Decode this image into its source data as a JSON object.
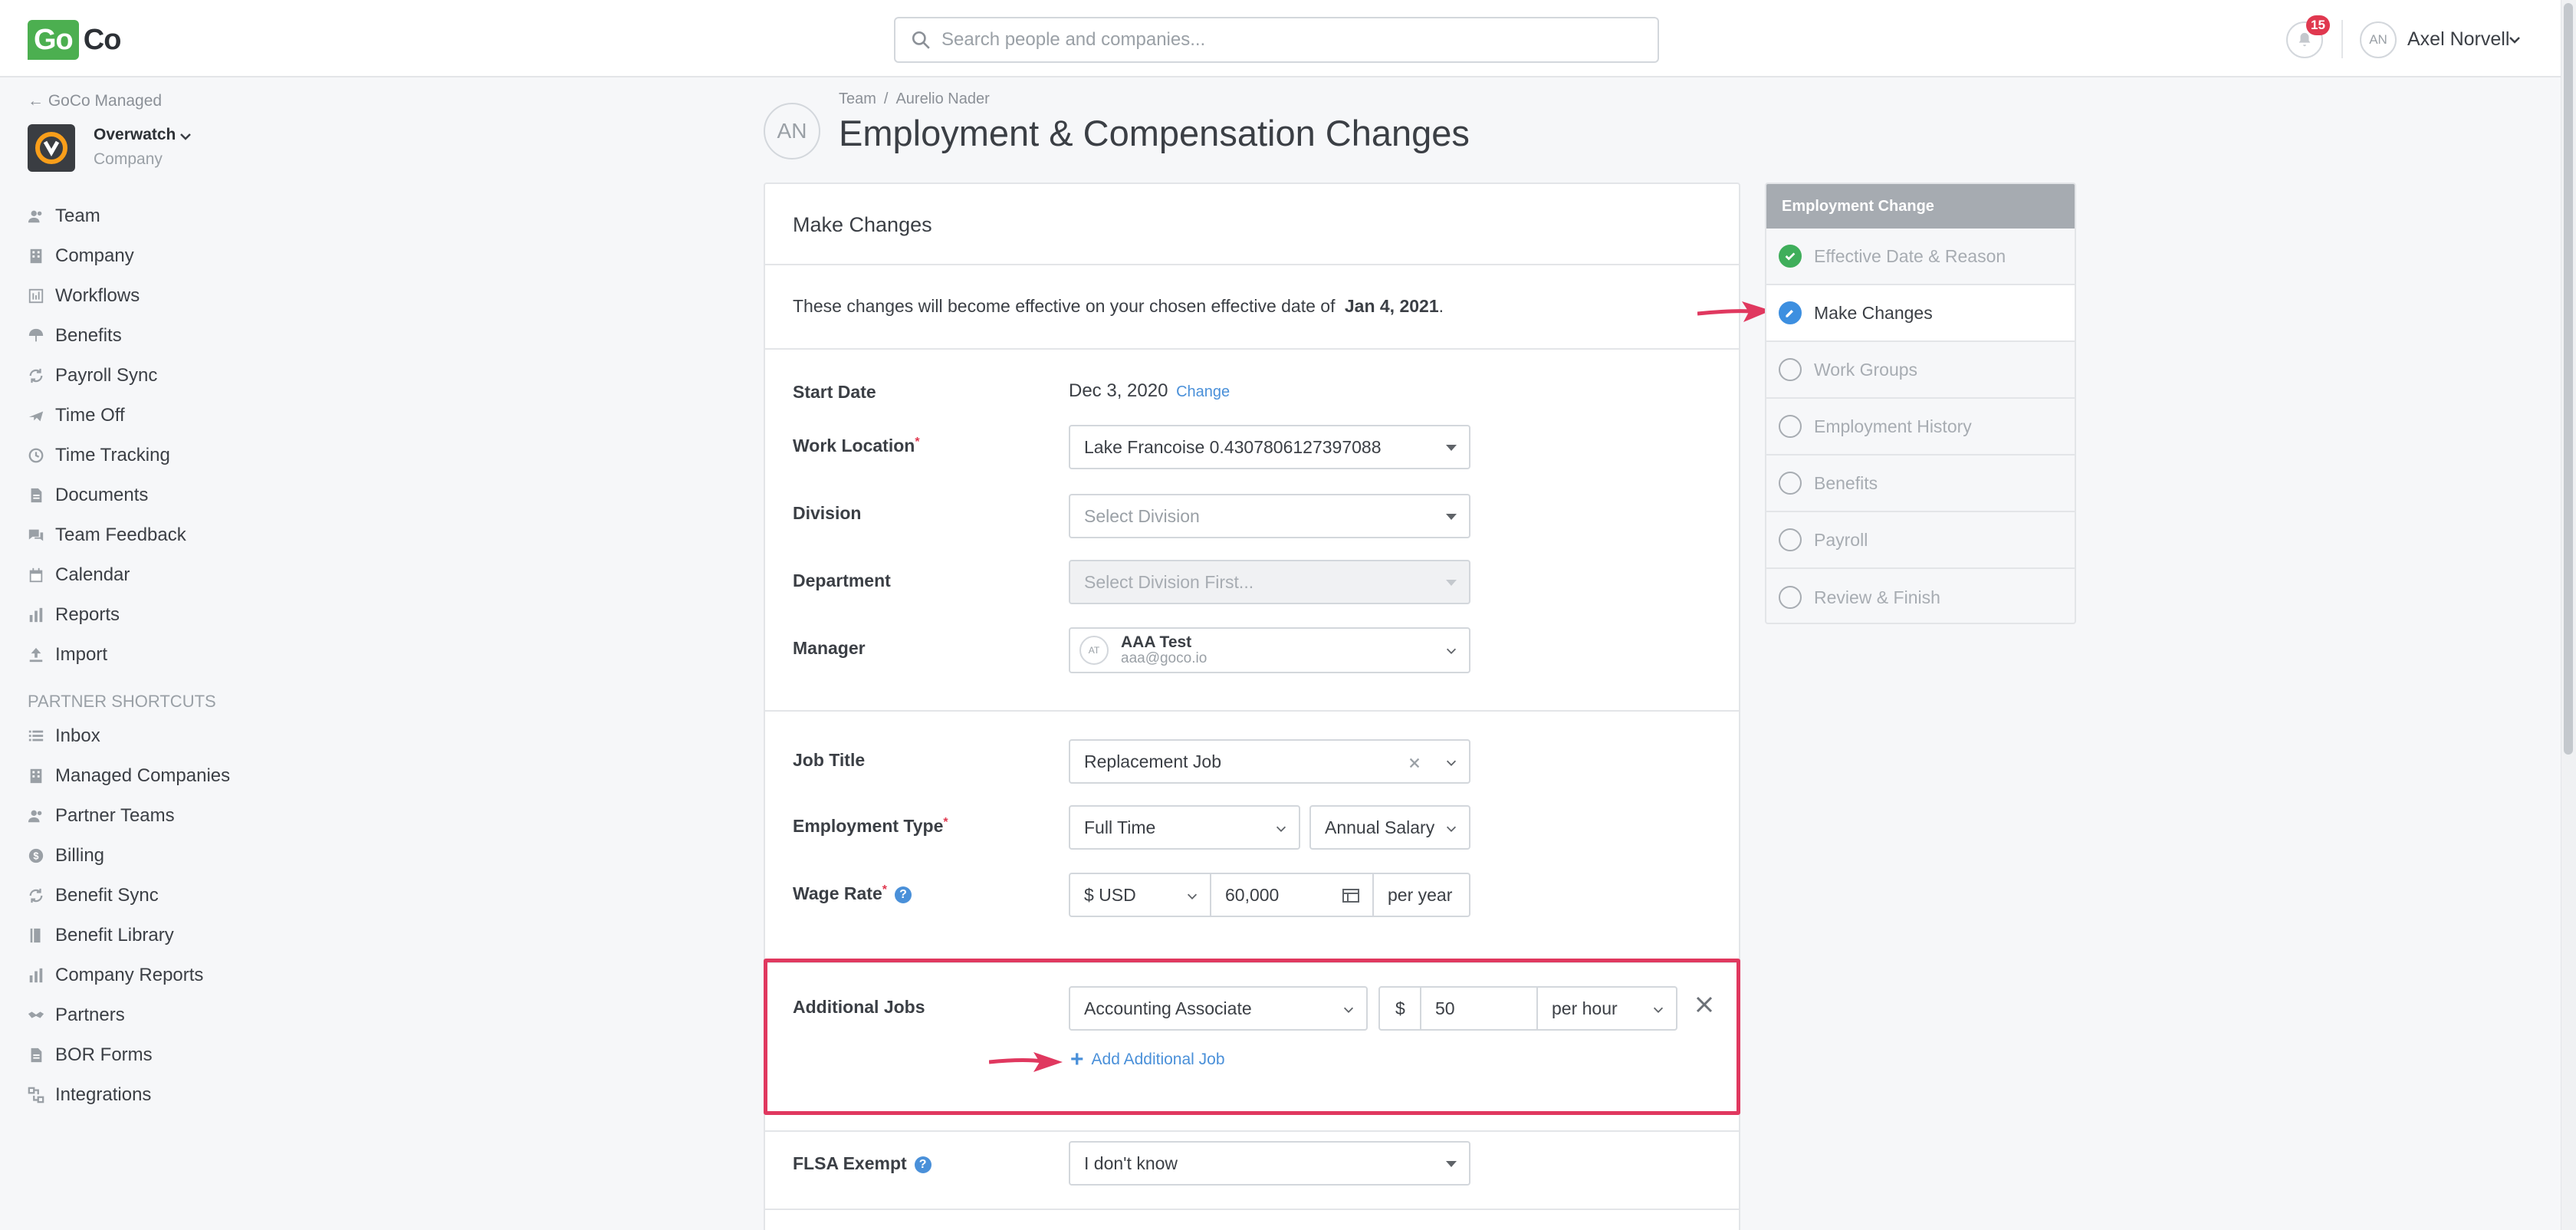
{
  "header": {
    "logo_go": "Go",
    "logo_co": "Co",
    "search_placeholder": "Search people and companies...",
    "notification_count": "15",
    "user_initials": "AN",
    "user_name": "Axel Norvell"
  },
  "sidebar": {
    "back_link": "← GoCo Managed",
    "company_name": "Overwatch",
    "company_sub": "Company",
    "items": [
      {
        "label": "Team",
        "icon": "people-icon"
      },
      {
        "label": "Company",
        "icon": "building-icon"
      },
      {
        "label": "Workflows",
        "icon": "workflow-icon"
      },
      {
        "label": "Benefits",
        "icon": "umbrella-icon"
      },
      {
        "label": "Payroll Sync",
        "icon": "sync-icon"
      },
      {
        "label": "Time Off",
        "icon": "plane-icon"
      },
      {
        "label": "Time Tracking",
        "icon": "clock-icon"
      },
      {
        "label": "Documents",
        "icon": "document-icon"
      },
      {
        "label": "Team Feedback",
        "icon": "chat-icon"
      },
      {
        "label": "Calendar",
        "icon": "calendar-icon"
      },
      {
        "label": "Reports",
        "icon": "bar-chart-icon"
      },
      {
        "label": "Import",
        "icon": "upload-icon"
      }
    ],
    "partner_heading": "PARTNER SHORTCUTS",
    "partner_items": [
      {
        "label": "Inbox",
        "icon": "list-icon"
      },
      {
        "label": "Managed Companies",
        "icon": "building-icon"
      },
      {
        "label": "Partner Teams",
        "icon": "people-icon"
      },
      {
        "label": "Billing",
        "icon": "dollar-icon"
      },
      {
        "label": "Benefit Sync",
        "icon": "sync-icon"
      },
      {
        "label": "Benefit Library",
        "icon": "book-icon"
      },
      {
        "label": "Company Reports",
        "icon": "bar-chart-icon"
      },
      {
        "label": "Partners",
        "icon": "handshake-icon"
      },
      {
        "label": "BOR Forms",
        "icon": "form-icon"
      },
      {
        "label": "Integrations",
        "icon": "integration-icon"
      }
    ]
  },
  "page": {
    "avatar_initials": "AN",
    "breadcrumb": [
      "Team",
      "Aurelio Nader"
    ],
    "title": "Employment & Compensation Changes"
  },
  "form": {
    "card_title": "Make Changes",
    "effective_text": "These changes will become effective on your chosen effective date of",
    "effective_date": "Jan 4, 2021",
    "effective_period": ".",
    "start_date_label": "Start Date",
    "start_date_value": "Dec 3, 2020",
    "start_date_change": "Change",
    "work_location_label": "Work Location",
    "required_mark": "*",
    "work_location_value": "Lake Francoise 0.4307806127397088",
    "division_label": "Division",
    "division_placeholder": "Select Division",
    "department_label": "Department",
    "department_placeholder": "Select Division First...",
    "manager_label": "Manager",
    "manager_initials": "AT",
    "manager_name": "AAA Test",
    "manager_email": "aaa@goco.io",
    "job_title_label": "Job Title",
    "job_title_value": "Replacement Job",
    "employment_type_label": "Employment Type",
    "employment_type_value": "Full Time",
    "pay_type_value": "Annual Salary",
    "wage_rate_label": "Wage Rate",
    "help_glyph": "?",
    "currency_value": "$ USD",
    "wage_amount": "60,000",
    "wage_period": "per year",
    "additional_jobs_label": "Additional Jobs",
    "additional_job_title": "Accounting Associate",
    "additional_job_currency": "$",
    "additional_job_rate": "50",
    "additional_job_period": "per hour",
    "add_job_plus": "+",
    "add_job_label": "Add Additional Job",
    "flsa_label": "FLSA Exempt",
    "flsa_value": "I don't know"
  },
  "steps": {
    "heading": "Employment Change",
    "items": [
      {
        "label": "Effective Date & Reason",
        "state": "done"
      },
      {
        "label": "Make Changes",
        "state": "current"
      },
      {
        "label": "Work Groups",
        "state": "pending"
      },
      {
        "label": "Employment History",
        "state": "pending"
      },
      {
        "label": "Benefits",
        "state": "pending"
      },
      {
        "label": "Payroll",
        "state": "pending"
      },
      {
        "label": "Review & Finish",
        "state": "pending"
      }
    ]
  },
  "colors": {
    "brand_green": "#4caf50",
    "accent_blue": "#4a90d9",
    "highlight_pink": "#e0385f",
    "badge_red": "#e0384f"
  }
}
